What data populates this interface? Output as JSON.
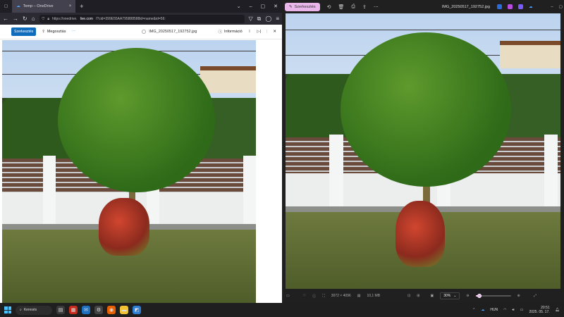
{
  "browser": {
    "tab_title": "Temp – OneDrive",
    "url_text": "https://onedrive.",
    "url_domain": "live.com",
    "url_rest": "/?cid=399E55AA795888588id=name&id=56:",
    "onedrive_toolbar": {
      "edit_label": "Szerkesztés",
      "share_label": "Megosztás",
      "more_label": "⋯",
      "filename": "IMG_20250517_192752.jpg",
      "info_label": "Információ"
    }
  },
  "photos_app": {
    "edit_label": "Szerkesztés",
    "filename": "IMG_20250517_192752.jpg",
    "dimensions": "3072 × 4096",
    "file_size": "10,1 MB",
    "zoom_value": "30%",
    "zoom_fraction": 0.1
  },
  "taskbar": {
    "search_label": "Keresés",
    "lang": "HUN",
    "time": "20:51",
    "date": "2025. 05. 17."
  },
  "colors": {
    "accent_blue": "#0f6cbd",
    "photos_accent": "#e9b6ea",
    "windows_blue": "#4cc2ff"
  }
}
